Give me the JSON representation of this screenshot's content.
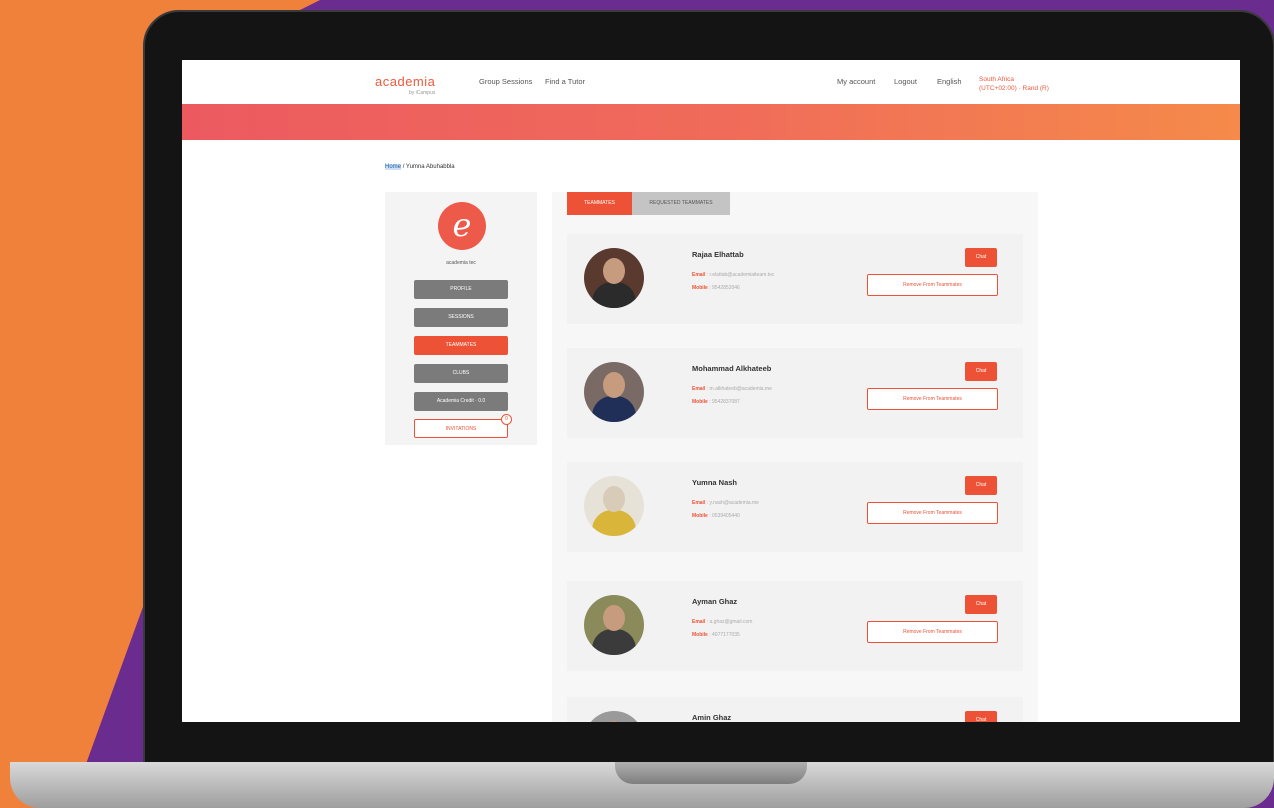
{
  "colors": {
    "accent": "#ee5236",
    "sidebar_button": "#7b7b7b",
    "background_purple": "#6a2c8f",
    "background_orange": "#f0813a"
  },
  "brand": {
    "logo_text": "academia",
    "logo_sub": "by iCampus"
  },
  "nav": {
    "links": [
      "Group Sessions",
      "Find a Tutor"
    ],
    "right_links": [
      "My account",
      "Logout",
      "English"
    ],
    "country": "South Africa",
    "country_sub": "(UTC+02:00) · Rand (R)"
  },
  "breadcrumb": {
    "highlight": "Home",
    "rest": "/ Yumna Abuhabbla"
  },
  "sidebar": {
    "name": "academia tec",
    "buttons": [
      "PROFILE",
      "SESSIONS",
      "TEAMMATES",
      "CLUBS",
      "Academia Credit · 0.0"
    ],
    "outline_button": "INVITATIONS",
    "badge": "0"
  },
  "tabs": [
    "TEAMMATES",
    "REQUESTED TEAMMATES"
  ],
  "teammates": [
    {
      "name": "Rajaa Elhattab",
      "email": "r.elattab@academiaiteam.tec",
      "mobile": "9542852046",
      "chat": "Chat",
      "remove": "Remove From Teammates"
    },
    {
      "name": "Mohammad Alkhateeb",
      "email": "m.alkhateeb@academia.me",
      "mobile": "9542837087",
      "chat": "Chat",
      "remove": "Remove From Teammates"
    },
    {
      "name": "Yumna Nash",
      "email": "y.nash@academia.me",
      "mobile": "0539405440",
      "chat": "Chat",
      "remove": "Remove From Teammates"
    },
    {
      "name": "Ayman Ghaz",
      "email": "a.ghaz@gmail.com",
      "mobile": "4077177035",
      "chat": "Chat",
      "remove": "Remove From Teammates"
    },
    {
      "name": "Amin Ghaz",
      "email": "",
      "mobile": "",
      "chat": "Chat",
      "remove": ""
    }
  ],
  "labels": {
    "email": "Email",
    "mobile": "Mobile"
  }
}
